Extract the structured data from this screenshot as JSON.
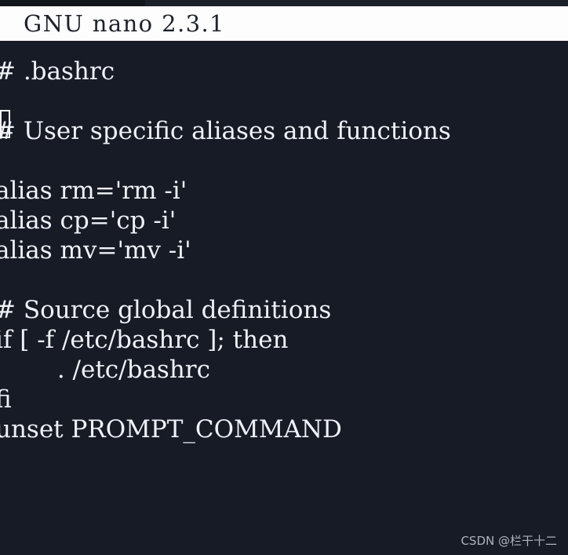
{
  "window": {
    "app_name": "GNU nano",
    "version": "2.3.1",
    "title": "GNU nano 2.3.1",
    "colors": {
      "titlebar_bg": "#fdfdfd",
      "titlebar_fg": "#1d222b",
      "editor_bg": "#171b26",
      "editor_fg": "#eef1f6",
      "strip_left": "#121519",
      "strip_right": "#1b2028",
      "watermark_fg": "#b9bfc9",
      "cursor_outline": "#f4f6fa"
    }
  },
  "editor": {
    "filename_hint": ".bashrc",
    "cursor": {
      "line": 1,
      "column": 1,
      "char": "#"
    },
    "lines": [
      "# .bashrc",
      "",
      "# User specific aliases and functions",
      "",
      "alias rm='rm -i'",
      "alias cp='cp -i'",
      "alias mv='mv -i'",
      "",
      "# Source global definitions",
      "if [ -f /etc/bashrc ]; then",
      "        . /etc/bashrc",
      "fi",
      "unset PROMPT_COMMAND"
    ]
  },
  "watermark": {
    "text": "CSDN @栏干十二"
  }
}
